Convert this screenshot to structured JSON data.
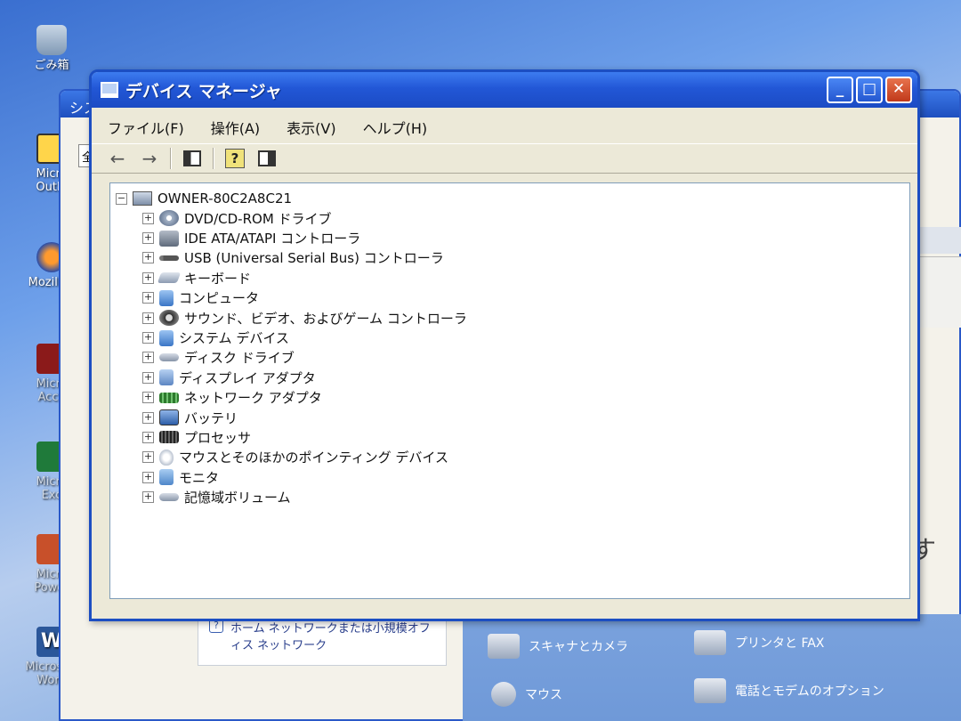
{
  "desktop": {
    "icons": [
      {
        "label": "ごみ箱"
      },
      {
        "label": "Micro",
        "label2": "Outlo"
      },
      {
        "label": "Mozilla I"
      },
      {
        "label": "Micro",
        "label2": "Acce"
      },
      {
        "label": "Micro",
        "label2": "Exc"
      },
      {
        "label": "Micro",
        "label2": "Power"
      },
      {
        "label": "Microsoft",
        "label2": "Word"
      }
    ]
  },
  "background_window": {
    "title": "シス",
    "tab": "全",
    "trailing_text": "ます"
  },
  "control_panel": {
    "task_label": "ホーム ネットワークまたは小規模オフィス ネットワーク",
    "items": [
      {
        "label": "スキャナとカメラ"
      },
      {
        "label": "プリンタと FAX"
      },
      {
        "label": "マウス"
      },
      {
        "label": "電話とモデムのオプション"
      }
    ]
  },
  "device_manager": {
    "title": "デバイス マネージャ",
    "menu": {
      "file": "ファイル(F)",
      "action": "操作(A)",
      "view": "表示(V)",
      "help": "ヘルプ(H)"
    },
    "tree": {
      "root": "OWNER-80C2A8C21",
      "categories": [
        {
          "label": "DVD/CD-ROM ドライブ",
          "icon": "dvd-drive-icon"
        },
        {
          "label": "IDE ATA/ATAPI コントローラ",
          "icon": "ide-controller-icon"
        },
        {
          "label": "USB (Universal Serial Bus) コントローラ",
          "icon": "usb-icon"
        },
        {
          "label": "キーボード",
          "icon": "keyboard-icon"
        },
        {
          "label": "コンピュータ",
          "icon": "computer-icon"
        },
        {
          "label": "サウンド、ビデオ、およびゲーム コントローラ",
          "icon": "sound-icon"
        },
        {
          "label": "システム デバイス",
          "icon": "system-device-icon"
        },
        {
          "label": "ディスク ドライブ",
          "icon": "disk-drive-icon"
        },
        {
          "label": "ディスプレイ アダプタ",
          "icon": "display-adapter-icon"
        },
        {
          "label": "ネットワーク アダプタ",
          "icon": "network-adapter-icon"
        },
        {
          "label": "バッテリ",
          "icon": "battery-icon"
        },
        {
          "label": "プロセッサ",
          "icon": "processor-icon"
        },
        {
          "label": "マウスとそのほかのポインティング デバイス",
          "icon": "mouse-icon"
        },
        {
          "label": "モニタ",
          "icon": "monitor-icon"
        },
        {
          "label": "記憶域ボリューム",
          "icon": "storage-volume-icon"
        }
      ]
    }
  }
}
